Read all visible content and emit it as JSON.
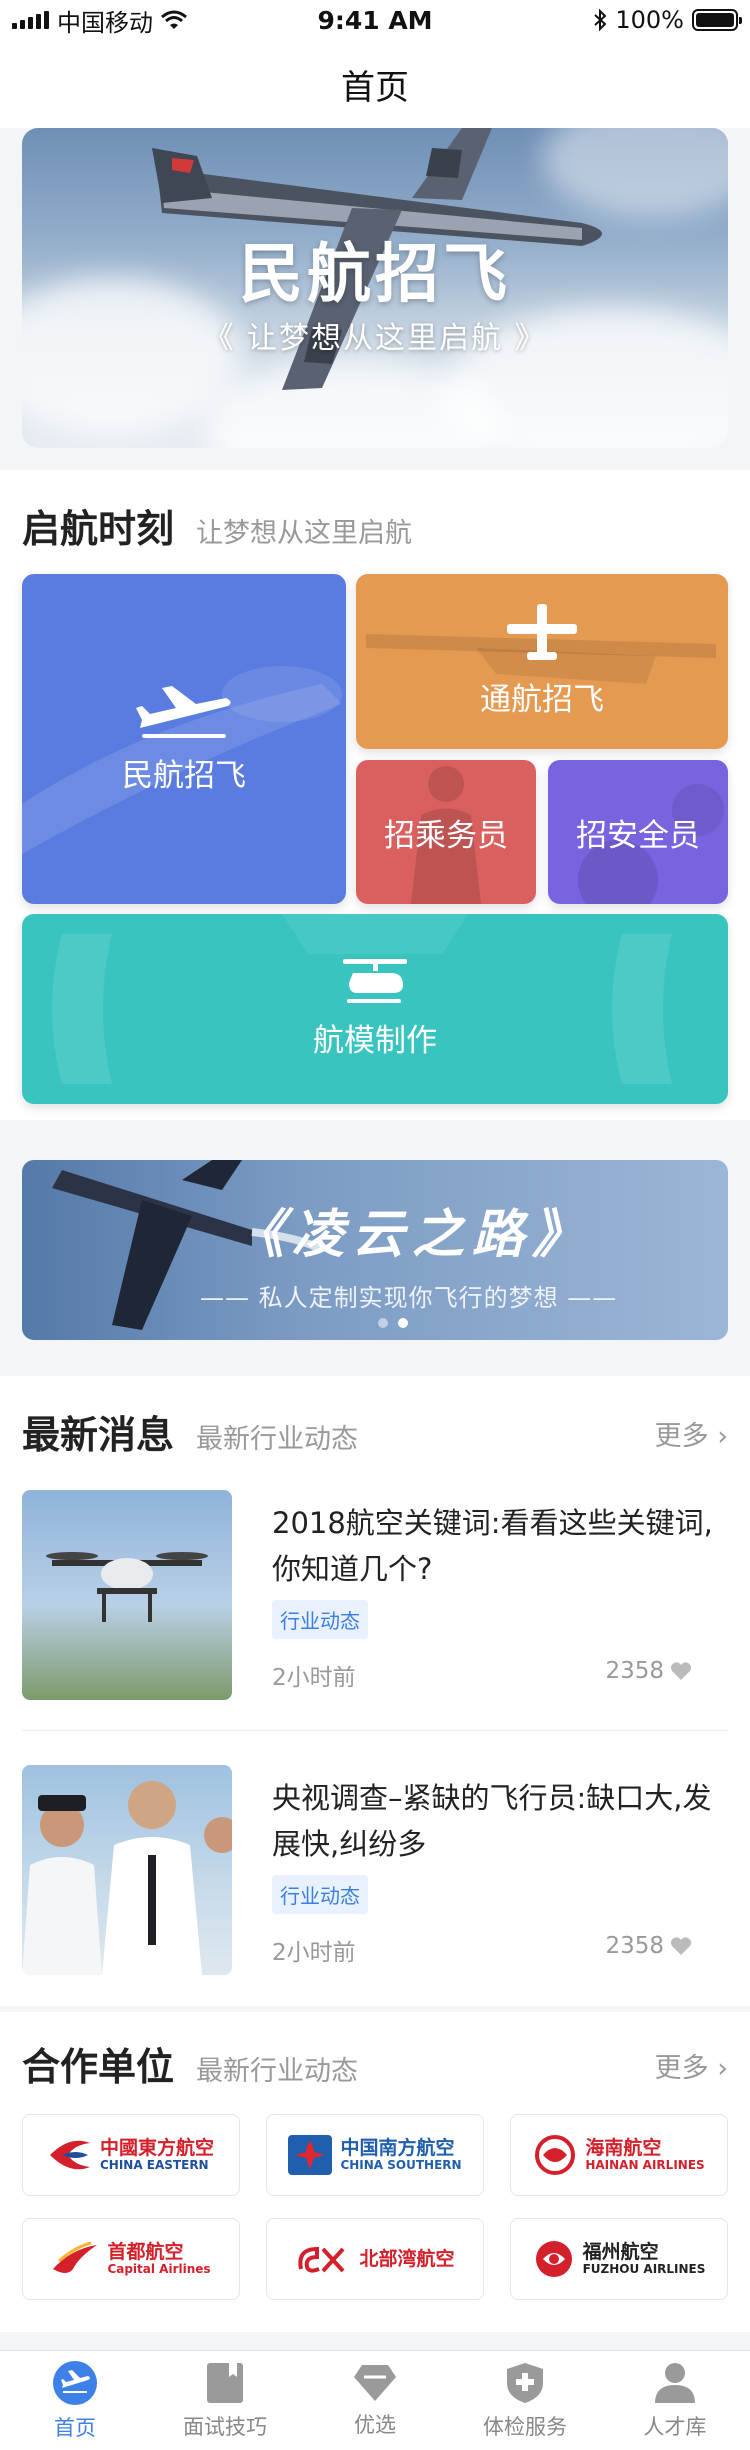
{
  "status_bar": {
    "carrier": "中国移动",
    "time": "9:41 AM",
    "battery": "100%"
  },
  "nav": {
    "title": "首页"
  },
  "hero": {
    "title": "民航招飞",
    "subtitle": "《 让梦想从这里启航 》"
  },
  "launch": {
    "title": "启航时刻",
    "subtitle": "让梦想从这里启航",
    "tiles": [
      {
        "label": "民航招飞",
        "color": "#5a7ce0"
      },
      {
        "label": "通航招飞",
        "color": "#e59a52"
      },
      {
        "label": "招乘务员",
        "color": "#d9605e"
      },
      {
        "label": "招安全员",
        "color": "#7b62de"
      },
      {
        "label": "航模制作",
        "color": "#39c4bf"
      }
    ]
  },
  "promo": {
    "title": "《凌云之路》",
    "subtitle": "—— 私人定制实现你飞行的梦想 ——"
  },
  "news": {
    "title": "最新消息",
    "subtitle": "最新行业动态",
    "more": "更多 ›",
    "items": [
      {
        "title": "2018航空关键词:看看这些关键词,你知道几个?",
        "tag": "行业动态",
        "time": "2小时前",
        "likes": "2358"
      },
      {
        "title": "央视调查–紧缺的飞行员:缺口大,发展快,纠纷多",
        "tag": "行业动态",
        "time": "2小时前",
        "likes": "2358"
      }
    ]
  },
  "partners": {
    "title": "合作单位",
    "subtitle": "最新行业动态",
    "more": "更多 ›",
    "items": [
      {
        "name": "中國東方航空",
        "en": "CHINA EASTERN",
        "color": "#d4202b"
      },
      {
        "name": "中国南方航空",
        "en": "CHINA SOUTHERN",
        "color": "#1f5fae"
      },
      {
        "name": "海南航空",
        "en": "HAINAN AIRLINES",
        "color": "#d4202b"
      },
      {
        "name": "首都航空",
        "en": "Capital Airlines",
        "color": "#d4202b"
      },
      {
        "name": "北部湾航空",
        "en": "",
        "color": "#d4202b"
      },
      {
        "name": "福州航空",
        "en": "FUZHOU AIRLINES",
        "color": "#222222"
      }
    ]
  },
  "tabbar": {
    "items": [
      {
        "label": "首页",
        "icon": "home-plane-icon"
      },
      {
        "label": "面试技巧",
        "icon": "book-icon"
      },
      {
        "label": "优选",
        "icon": "diamond-icon"
      },
      {
        "label": "体检服务",
        "icon": "shield-plus-icon"
      },
      {
        "label": "人才库",
        "icon": "person-icon"
      }
    ],
    "active_color": "#3c80e8"
  }
}
